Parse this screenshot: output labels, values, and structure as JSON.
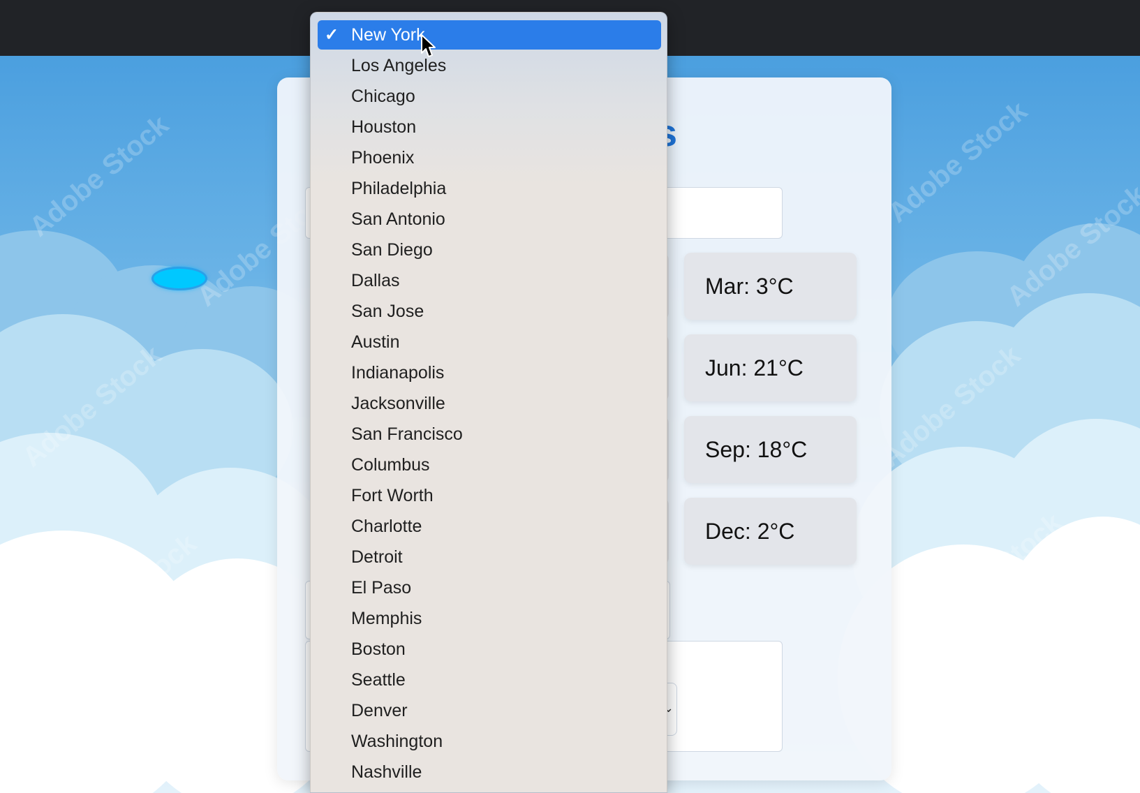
{
  "dropdown": {
    "selected_index": 0,
    "options": [
      "New York",
      "Los Angeles",
      "Chicago",
      "Houston",
      "Phoenix",
      "Philadelphia",
      "San Antonio",
      "San Diego",
      "Dallas",
      "San Jose",
      "Austin",
      "Indianapolis",
      "Jacksonville",
      "San Francisco",
      "Columbus",
      "Fort Worth",
      "Charlotte",
      "Detroit",
      "El Paso",
      "Memphis",
      "Boston",
      "Seattle",
      "Denver",
      "Washington",
      "Nashville"
    ],
    "check_glyph": "✓"
  },
  "card": {
    "title_tail": "s"
  },
  "temperatures": [
    {
      "label": "Mar: 3°C"
    },
    {
      "label": "Jun: 21°C"
    },
    {
      "label": "Sep: 18°C"
    },
    {
      "label": "Dec: 2°C"
    }
  ],
  "background": {
    "watermark_text": "Adobe Stock"
  },
  "colors": {
    "topbar": "#212327",
    "accent": "#2b7de9",
    "title": "#1e74d8"
  },
  "icons": {
    "selected": "checkmark-icon",
    "pointer": "mouse-cursor-icon"
  }
}
